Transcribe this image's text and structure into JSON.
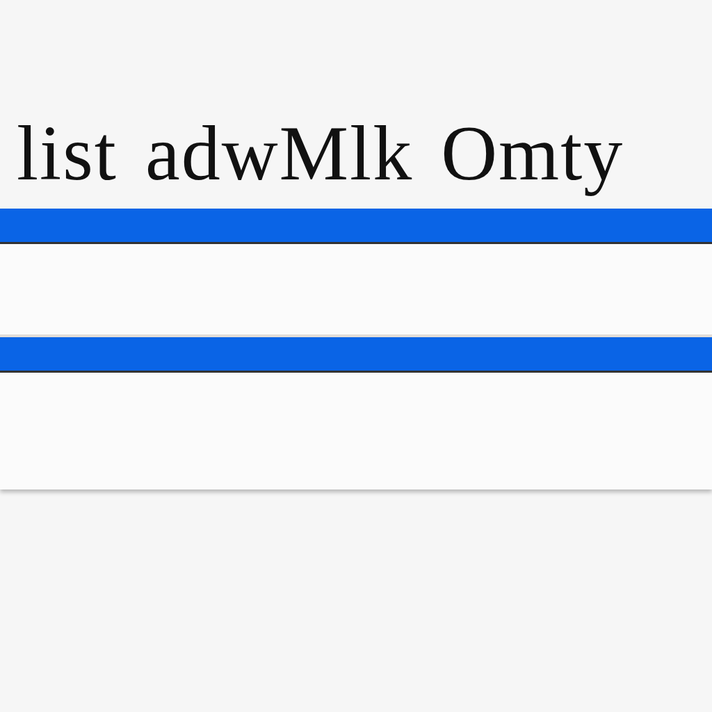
{
  "heading": "list adwMlk Omty",
  "rows": [
    {
      "kind": "bar"
    },
    {
      "kind": "field"
    },
    {
      "kind": "bar"
    },
    {
      "kind": "field"
    }
  ]
}
